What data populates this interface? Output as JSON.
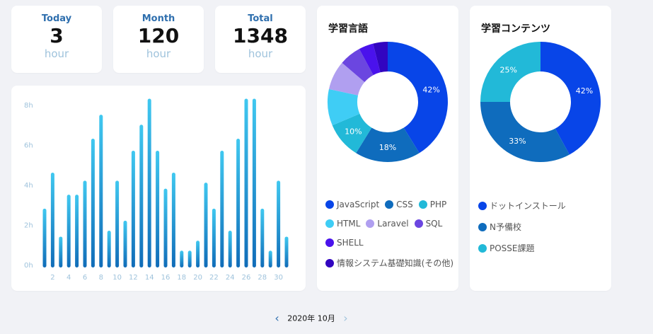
{
  "stats": [
    {
      "label": "Today",
      "value": "3",
      "unit": "hour"
    },
    {
      "label": "Month",
      "value": "120",
      "unit": "hour"
    },
    {
      "label": "Total",
      "value": "1348",
      "unit": "hour"
    }
  ],
  "colors": {
    "bar_top": "#40c8f0",
    "bar_bottom": "#106cb8",
    "accent": "#2f6fae",
    "axis_text": "#9fc3dc"
  },
  "chart_data": [
    {
      "type": "bar",
      "x": [
        1,
        2,
        3,
        4,
        5,
        6,
        7,
        8,
        9,
        10,
        11,
        12,
        13,
        14,
        15,
        16,
        17,
        18,
        19,
        20,
        21,
        22,
        23,
        24,
        25,
        26,
        27,
        28,
        29,
        30,
        31
      ],
      "values": [
        2.8,
        4.6,
        1.4,
        3.5,
        3.5,
        4.2,
        6.3,
        7.5,
        1.7,
        4.2,
        2.2,
        5.7,
        7.0,
        8.3,
        5.7,
        3.8,
        4.6,
        0.7,
        0.7,
        1.2,
        4.1,
        2.8,
        5.7,
        1.7,
        6.3,
        8.3,
        8.3,
        2.8,
        0.7,
        4.2,
        1.4
      ],
      "xticks": [
        "2",
        "4",
        "6",
        "8",
        "10",
        "12",
        "14",
        "16",
        "18",
        "20",
        "22",
        "24",
        "26",
        "28",
        "30"
      ],
      "yticks": [
        "0h",
        "2h",
        "4h",
        "6h",
        "8h"
      ],
      "ylim": [
        0,
        8
      ],
      "grid": false
    },
    {
      "type": "pie",
      "title": "学習言語",
      "labels": [
        "JavaScript",
        "CSS",
        "PHP",
        "HTML",
        "Laravel",
        "SQL",
        "SHELL",
        "情報システム基礎知識(その他)"
      ],
      "values": [
        42,
        18,
        10,
        10,
        8,
        6,
        4,
        4
      ],
      "slice_labels": [
        "42%",
        "18%",
        "10%",
        "",
        "",
        "",
        "",
        ""
      ],
      "colors": [
        "#0845e8",
        "#0f6cbd",
        "#22b9d8",
        "#3fcdf5",
        "#b09ff0",
        "#6b46e0",
        "#4a12ec",
        "#3205c0"
      ]
    },
    {
      "type": "pie",
      "title": "学習コンテンツ",
      "labels": [
        "ドットインストール",
        "N予備校",
        "POSSE課題"
      ],
      "values": [
        42,
        33,
        25
      ],
      "slice_labels": [
        "42%",
        "33%",
        "25%"
      ],
      "colors": [
        "#0845e8",
        "#0f6cbd",
        "#22b9d8"
      ]
    }
  ],
  "pager": {
    "prev_icon": "‹",
    "label": "2020年 10月",
    "next_icon": "›"
  }
}
